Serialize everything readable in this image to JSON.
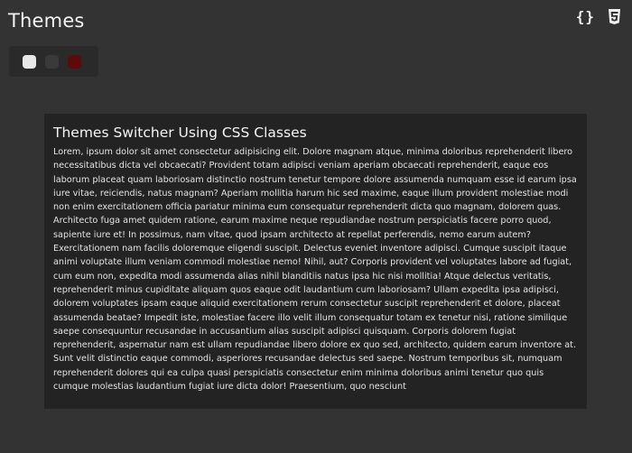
{
  "header": {
    "title": "Themes",
    "icons": [
      "braces-icon",
      "css3-icon"
    ]
  },
  "theme_switcher": {
    "swatches": [
      {
        "name": "light-theme-swatch",
        "color": "#e8e8e8"
      },
      {
        "name": "dark-theme-swatch",
        "color": "#3a3a3a"
      },
      {
        "name": "red-theme-swatch",
        "color": "#5c0a0a"
      }
    ]
  },
  "card": {
    "title": "Themes Switcher Using CSS Classes",
    "body": "Lorem, ipsum dolor sit amet consectetur adipisicing elit. Dolore magnam atque, minima doloribus reprehenderit libero necessitatibus dicta vel obcaecati? Provident totam adipisci veniam aperiam obcaecati reprehenderit, eaque eos laborum placeat quam laboriosam distinctio nostrum tenetur tempore dolore assumenda numquam esse id earum ipsa iure vitae, reiciendis, natus magnam? Aperiam mollitia harum hic sed maxime, eaque illum provident molestiae modi non enim exercitationem officia pariatur minima eum consequatur reprehenderit dicta quo magnam, dolorem quas. Architecto fuga amet quidem ratione, earum maxime neque repudiandae nostrum perspiciatis facere porro quod, sapiente iure et! In possimus, nam vitae, quod ipsam architecto at repellat perferendis, nemo earum autem? Exercitationem nam facilis doloremque eligendi suscipit. Delectus eveniet inventore adipisci. Cumque suscipit itaque animi voluptate illum veniam commodi molestiae nemo! Nihil, aut? Corporis provident vel voluptates labore ad fugiat, cum eum non, expedita modi assumenda alias nihil blanditiis natus ipsa hic nisi mollitia! Atque delectus veritatis, reprehenderit minus cupiditate aliquam quos eaque odit laudantium cum laboriosam? Ullam expedita ipsa adipisci, dolorem voluptates ipsam eaque aliquid exercitationem rerum consectetur suscipit reprehenderit et dolore, placeat assumenda beatae? Impedit iste, molestiae facere illo velit illum consequatur totam ex tenetur nisi, ratione similique saepe consequuntur recusandae in accusantium alias suscipit adipisci quisquam. Corporis dolorem fugiat reprehenderit, aspernatur nam est ullam repudiandae libero dolore ex quo sed, architecto, quidem earum inventore at. Sunt velit distinctio eaque commodi, asperiores recusandae delectus sed saepe. Nostrum temporibus sit, numquam reprehenderit dolores qui ea culpa quasi perspiciatis consectetur enim minima doloribus animi tenetur quo quis cumque molestias laudantium fugiat iure dicta dolor! Praesentium, quo nesciunt"
  },
  "colors": {
    "background": "#333333",
    "card_background": "#232323",
    "switcher_background": "#2a2a2a"
  }
}
